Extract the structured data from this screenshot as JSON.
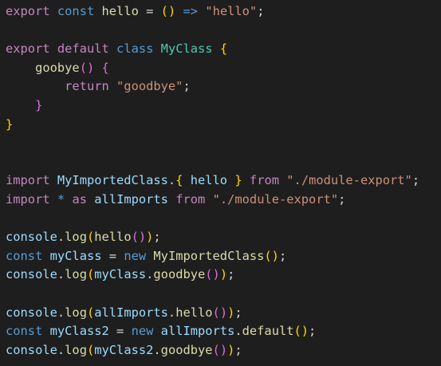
{
  "theme": {
    "background": "#1e1e1e",
    "default_text": "#d4d4d4",
    "keyword_control": "#c586c0",
    "keyword_storage": "#569cd6",
    "variable": "#9cdcfe",
    "function": "#dcdcaa",
    "class": "#4ec9b0",
    "string": "#ce9178",
    "bracket_level_1": "#ffd700",
    "bracket_level_2": "#da70d6",
    "bracket_level_3": "#179fff"
  },
  "code_lines": [
    [
      {
        "t": "export",
        "c": "kw-purple"
      },
      {
        "t": " ",
        "c": "punc"
      },
      {
        "t": "const",
        "c": "kw-blue"
      },
      {
        "t": " ",
        "c": "punc"
      },
      {
        "t": "hello",
        "c": "func"
      },
      {
        "t": " = ",
        "c": "punc"
      },
      {
        "t": "()",
        "c": "brk1"
      },
      {
        "t": " ",
        "c": "punc"
      },
      {
        "t": "=>",
        "c": "kw-blue"
      },
      {
        "t": " ",
        "c": "punc"
      },
      {
        "t": "\"hello\"",
        "c": "str"
      },
      {
        "t": ";",
        "c": "punc"
      }
    ],
    [],
    [
      {
        "t": "export",
        "c": "kw-purple"
      },
      {
        "t": " ",
        "c": "punc"
      },
      {
        "t": "default",
        "c": "kw-purple"
      },
      {
        "t": " ",
        "c": "punc"
      },
      {
        "t": "class",
        "c": "kw-blue"
      },
      {
        "t": " ",
        "c": "punc"
      },
      {
        "t": "MyClass",
        "c": "cls"
      },
      {
        "t": " ",
        "c": "punc"
      },
      {
        "t": "{",
        "c": "brk1"
      }
    ],
    [
      {
        "t": "    ",
        "c": "punc"
      },
      {
        "t": "goobye",
        "c": "func"
      },
      {
        "t": "()",
        "c": "brk2"
      },
      {
        "t": " ",
        "c": "punc"
      },
      {
        "t": "{",
        "c": "brk2"
      }
    ],
    [
      {
        "t": "        ",
        "c": "punc"
      },
      {
        "t": "return",
        "c": "kw-purple"
      },
      {
        "t": " ",
        "c": "punc"
      },
      {
        "t": "\"goodbye\"",
        "c": "str"
      },
      {
        "t": ";",
        "c": "punc"
      }
    ],
    [
      {
        "t": "    ",
        "c": "punc"
      },
      {
        "t": "}",
        "c": "brk2"
      }
    ],
    [
      {
        "t": "}",
        "c": "brk1"
      }
    ],
    [],
    [],
    [
      {
        "t": "import",
        "c": "kw-purple"
      },
      {
        "t": " ",
        "c": "punc"
      },
      {
        "t": "MyImportedClass",
        "c": "ident"
      },
      {
        "t": ".",
        "c": "punc"
      },
      {
        "t": "{",
        "c": "brk1"
      },
      {
        "t": " ",
        "c": "punc"
      },
      {
        "t": "hello",
        "c": "ident"
      },
      {
        "t": " ",
        "c": "punc"
      },
      {
        "t": "}",
        "c": "brk1"
      },
      {
        "t": " ",
        "c": "punc"
      },
      {
        "t": "from",
        "c": "kw-purple"
      },
      {
        "t": " ",
        "c": "punc"
      },
      {
        "t": "\"./module-export\"",
        "c": "str"
      },
      {
        "t": ";",
        "c": "punc"
      }
    ],
    [
      {
        "t": "import",
        "c": "kw-purple"
      },
      {
        "t": " ",
        "c": "punc"
      },
      {
        "t": "*",
        "c": "kw-blue"
      },
      {
        "t": " ",
        "c": "punc"
      },
      {
        "t": "as",
        "c": "kw-purple"
      },
      {
        "t": " ",
        "c": "punc"
      },
      {
        "t": "allImports",
        "c": "ident"
      },
      {
        "t": " ",
        "c": "punc"
      },
      {
        "t": "from",
        "c": "kw-purple"
      },
      {
        "t": " ",
        "c": "punc"
      },
      {
        "t": "\"./module-export\"",
        "c": "str"
      },
      {
        "t": ";",
        "c": "punc"
      }
    ],
    [],
    [
      {
        "t": "console",
        "c": "ident"
      },
      {
        "t": ".",
        "c": "punc"
      },
      {
        "t": "log",
        "c": "func"
      },
      {
        "t": "(",
        "c": "brk1"
      },
      {
        "t": "hello",
        "c": "func"
      },
      {
        "t": "()",
        "c": "brk2"
      },
      {
        "t": ")",
        "c": "brk1"
      },
      {
        "t": ";",
        "c": "punc"
      }
    ],
    [
      {
        "t": "const",
        "c": "kw-blue"
      },
      {
        "t": " ",
        "c": "punc"
      },
      {
        "t": "myClass",
        "c": "ident"
      },
      {
        "t": " = ",
        "c": "punc"
      },
      {
        "t": "new",
        "c": "kw-blue"
      },
      {
        "t": " ",
        "c": "punc"
      },
      {
        "t": "MyImportedClass",
        "c": "func"
      },
      {
        "t": "()",
        "c": "brk1"
      },
      {
        "t": ";",
        "c": "punc"
      }
    ],
    [
      {
        "t": "console",
        "c": "ident"
      },
      {
        "t": ".",
        "c": "punc"
      },
      {
        "t": "log",
        "c": "func"
      },
      {
        "t": "(",
        "c": "brk1"
      },
      {
        "t": "myClass",
        "c": "ident"
      },
      {
        "t": ".",
        "c": "punc"
      },
      {
        "t": "goodbye",
        "c": "func"
      },
      {
        "t": "()",
        "c": "brk2"
      },
      {
        "t": ")",
        "c": "brk1"
      },
      {
        "t": ";",
        "c": "punc"
      }
    ],
    [],
    [
      {
        "t": "console",
        "c": "ident"
      },
      {
        "t": ".",
        "c": "punc"
      },
      {
        "t": "log",
        "c": "func"
      },
      {
        "t": "(",
        "c": "brk1"
      },
      {
        "t": "allImports",
        "c": "ident"
      },
      {
        "t": ".",
        "c": "punc"
      },
      {
        "t": "hello",
        "c": "func"
      },
      {
        "t": "()",
        "c": "brk2"
      },
      {
        "t": ")",
        "c": "brk1"
      },
      {
        "t": ";",
        "c": "punc"
      }
    ],
    [
      {
        "t": "const",
        "c": "kw-blue"
      },
      {
        "t": " ",
        "c": "punc"
      },
      {
        "t": "myClass2",
        "c": "ident"
      },
      {
        "t": " = ",
        "c": "punc"
      },
      {
        "t": "new",
        "c": "kw-blue"
      },
      {
        "t": " ",
        "c": "punc"
      },
      {
        "t": "allImports",
        "c": "ident"
      },
      {
        "t": ".",
        "c": "punc"
      },
      {
        "t": "default",
        "c": "func"
      },
      {
        "t": "()",
        "c": "brk1"
      },
      {
        "t": ";",
        "c": "punc"
      }
    ],
    [
      {
        "t": "console",
        "c": "ident"
      },
      {
        "t": ".",
        "c": "punc"
      },
      {
        "t": "log",
        "c": "func"
      },
      {
        "t": "(",
        "c": "brk1"
      },
      {
        "t": "myClass2",
        "c": "ident"
      },
      {
        "t": ".",
        "c": "punc"
      },
      {
        "t": "goodbye",
        "c": "func"
      },
      {
        "t": "()",
        "c": "brk2"
      },
      {
        "t": ")",
        "c": "brk1"
      },
      {
        "t": ";",
        "c": "punc"
      }
    ]
  ]
}
